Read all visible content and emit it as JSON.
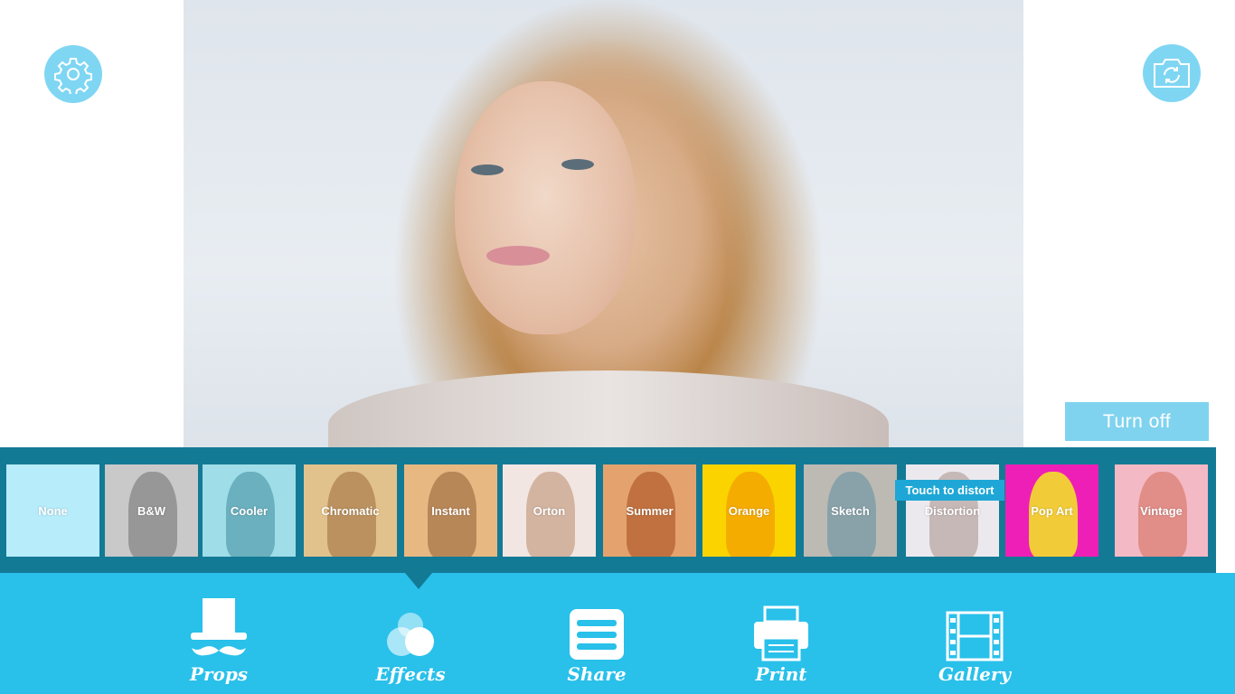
{
  "controls": {
    "settings_icon": "gear-icon",
    "camera_switch_icon": "camera-rotate-icon",
    "turn_off_label": "Turn off"
  },
  "effects": {
    "tooltip": "Touch to distort",
    "items": [
      {
        "label": "None",
        "color": "#b7ecfb"
      },
      {
        "label": "B&W",
        "color": "#c9c9c9"
      },
      {
        "label": "Cooler",
        "color": "#9fdde8"
      },
      {
        "label": "Chromatic",
        "color": "#e2c28c"
      },
      {
        "label": "Instant",
        "color": "#e8b882"
      },
      {
        "label": "Orton",
        "color": "#f2e6e2"
      },
      {
        "label": "Summer",
        "color": "#e4a36e"
      },
      {
        "label": "Orange",
        "color": "#fbd400"
      },
      {
        "label": "Sketch",
        "color": "#bdbab4"
      },
      {
        "label": "Distortion",
        "color": "#ece9ee"
      },
      {
        "label": "Pop Art",
        "color": "#ee1fb6"
      },
      {
        "label": "Vintage",
        "color": "#f3b9c4"
      }
    ]
  },
  "nav": {
    "items": [
      {
        "label": "Props",
        "icon": "top-hat-mustache-icon"
      },
      {
        "label": "Effects",
        "icon": "circles-icon"
      },
      {
        "label": "Share",
        "icon": "menu-lines-icon"
      },
      {
        "label": "Print",
        "icon": "printer-icon"
      },
      {
        "label": "Gallery",
        "icon": "film-strip-icon"
      }
    ],
    "active": "Effects"
  },
  "colors": {
    "accent": "#29c0ea",
    "strip": "#137a96",
    "button": "#7fd6f3"
  }
}
